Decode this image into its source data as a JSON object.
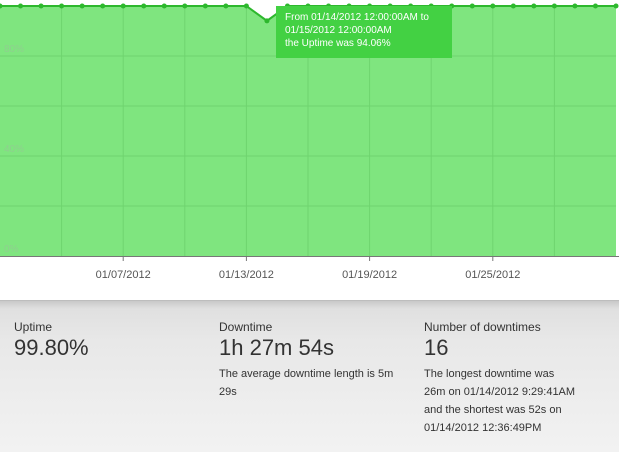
{
  "chart_data": {
    "type": "area",
    "y_ticks": [
      "0%",
      "40%",
      "80%"
    ],
    "x_ticks": [
      "01/07/2012",
      "01/13/2012",
      "01/19/2012",
      "01/25/2012"
    ],
    "ylim": [
      0,
      100
    ],
    "series": [
      {
        "values": [
          100,
          100,
          100,
          100,
          100,
          100,
          100,
          100,
          100,
          100,
          100,
          100,
          100,
          94.06,
          100,
          100,
          100,
          100,
          100,
          100,
          100,
          100,
          100,
          100,
          100,
          100,
          100,
          100,
          100,
          100,
          100
        ]
      }
    ],
    "fill_color": "#7fe57f",
    "line_color": "#2db82d",
    "grid": true
  },
  "tooltip": {
    "line1": "From 01/14/2012 12:00:00AM to",
    "line2": "01/15/2012 12:00:00AM",
    "line3": "the Uptime was 94.06%"
  },
  "stats": {
    "uptime": {
      "label": "Uptime",
      "value": "99.80%"
    },
    "downtime": {
      "label": "Downtime",
      "value": "1h 27m 54s",
      "desc": "The average downtime length is 5m 29s"
    },
    "count": {
      "label": "Number of downtimes",
      "value": "16",
      "desc_line1": "The longest downtime was",
      "desc_line2": "26m on 01/14/2012 9:29:41AM",
      "desc_line3": "and the shortest was 52s on",
      "desc_line4": "01/14/2012 12:36:49PM"
    }
  }
}
